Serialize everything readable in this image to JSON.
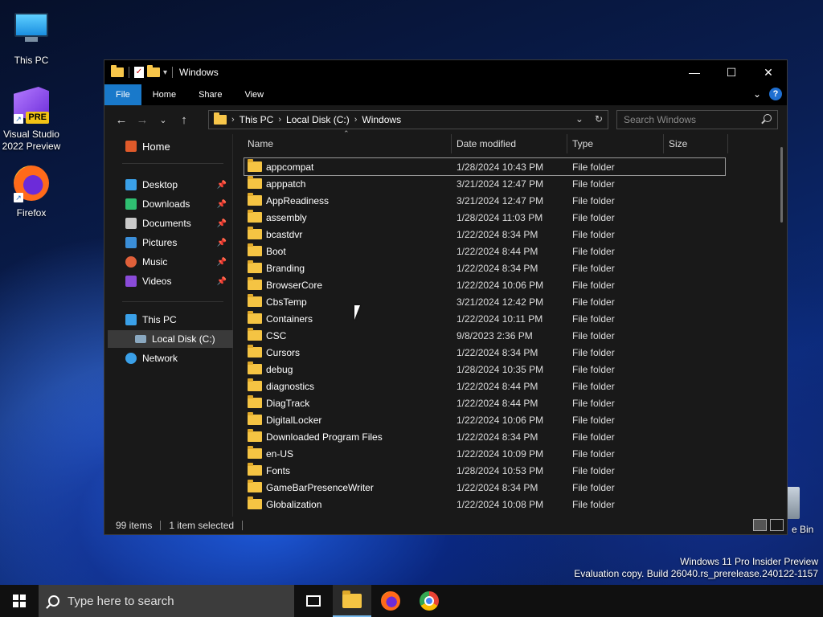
{
  "desktop": {
    "icons": [
      {
        "label": "This PC"
      },
      {
        "label": "Visual Studio 2022 Preview",
        "badge": "PRE"
      },
      {
        "label": "Firefox"
      }
    ],
    "recycle_bin_label": "e Bin",
    "watermark": {
      "line1": "Windows 11 Pro Insider Preview",
      "line2": "Evaluation copy. Build 26040.rs_prerelease.240122-1157"
    }
  },
  "window": {
    "title": "Windows",
    "controls": {
      "minimize": "—",
      "maximize": "☐",
      "close": "✕"
    },
    "ribbon_tabs": [
      "File",
      "Home",
      "Share",
      "View"
    ],
    "help_label": "?",
    "address": {
      "crumbs": [
        "This PC",
        "Local Disk (C:)",
        "Windows"
      ]
    },
    "search": {
      "placeholder": "Search Windows"
    },
    "nav": {
      "home": "Home",
      "quick_access": [
        "Desktop",
        "Downloads",
        "Documents",
        "Pictures",
        "Music",
        "Videos"
      ],
      "this_pc": "This PC",
      "local_disk": "Local Disk (C:)",
      "network": "Network"
    },
    "columns": [
      "Name",
      "Date modified",
      "Type",
      "Size"
    ],
    "files": [
      {
        "name": "appcompat",
        "date": "1/28/2024 10:43 PM",
        "type": "File folder"
      },
      {
        "name": "apppatch",
        "date": "3/21/2024 12:47 PM",
        "type": "File folder"
      },
      {
        "name": "AppReadiness",
        "date": "3/21/2024 12:47 PM",
        "type": "File folder"
      },
      {
        "name": "assembly",
        "date": "1/28/2024 11:03 PM",
        "type": "File folder"
      },
      {
        "name": "bcastdvr",
        "date": "1/22/2024 8:34 PM",
        "type": "File folder"
      },
      {
        "name": "Boot",
        "date": "1/22/2024 8:44 PM",
        "type": "File folder"
      },
      {
        "name": "Branding",
        "date": "1/22/2024 8:34 PM",
        "type": "File folder"
      },
      {
        "name": "BrowserCore",
        "date": "1/22/2024 10:06 PM",
        "type": "File folder"
      },
      {
        "name": "CbsTemp",
        "date": "3/21/2024 12:42 PM",
        "type": "File folder"
      },
      {
        "name": "Containers",
        "date": "1/22/2024 10:11 PM",
        "type": "File folder"
      },
      {
        "name": "CSC",
        "date": "9/8/2023 2:36 PM",
        "type": "File folder"
      },
      {
        "name": "Cursors",
        "date": "1/22/2024 8:34 PM",
        "type": "File folder"
      },
      {
        "name": "debug",
        "date": "1/28/2024 10:35 PM",
        "type": "File folder"
      },
      {
        "name": "diagnostics",
        "date": "1/22/2024 8:44 PM",
        "type": "File folder"
      },
      {
        "name": "DiagTrack",
        "date": "1/22/2024 8:44 PM",
        "type": "File folder"
      },
      {
        "name": "DigitalLocker",
        "date": "1/22/2024 10:06 PM",
        "type": "File folder"
      },
      {
        "name": "Downloaded Program Files",
        "date": "1/22/2024 8:34 PM",
        "type": "File folder"
      },
      {
        "name": "en-US",
        "date": "1/22/2024 10:09 PM",
        "type": "File folder"
      },
      {
        "name": "Fonts",
        "date": "1/28/2024 10:53 PM",
        "type": "File folder"
      },
      {
        "name": "GameBarPresenceWriter",
        "date": "1/22/2024 8:34 PM",
        "type": "File folder"
      },
      {
        "name": "Globalization",
        "date": "1/22/2024 10:08 PM",
        "type": "File folder"
      }
    ],
    "status": {
      "items": "99 items",
      "selected": "1 item selected"
    }
  },
  "taskbar": {
    "search_placeholder": "Type here to search"
  },
  "colors": {
    "accent": "#1979ca",
    "folder": "#f5c443",
    "window_bg": "#191919"
  }
}
